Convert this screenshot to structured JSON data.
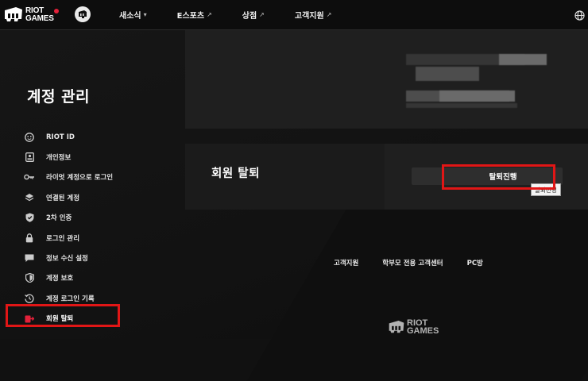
{
  "header": {
    "brand_line1": "RIOT",
    "brand_line2": "GAMES",
    "nav": [
      {
        "label": "새소식",
        "suffix": "▾"
      },
      {
        "label": "E스포츠",
        "suffix": "↗"
      },
      {
        "label": "상점",
        "suffix": "↗"
      },
      {
        "label": "고객지원",
        "suffix": "↗"
      }
    ],
    "globe_icon": "globe-icon"
  },
  "page": {
    "title": "계정 관리"
  },
  "sidebar": {
    "items": [
      {
        "label": "RIOT ID",
        "icon": "face-icon"
      },
      {
        "label": "개인정보",
        "icon": "id-card-icon"
      },
      {
        "label": "라이엇 계정으로 로그인",
        "icon": "key-icon"
      },
      {
        "label": "연결된 계정",
        "icon": "layers-icon"
      },
      {
        "label": "2차 인증",
        "icon": "shield-check-icon"
      },
      {
        "label": "로그인 관리",
        "icon": "lock-icon"
      },
      {
        "label": "정보 수신 설정",
        "icon": "chat-icon"
      },
      {
        "label": "계정 보호",
        "icon": "shield-lock-icon"
      },
      {
        "label": "계정 로그인 기록",
        "icon": "history-icon"
      },
      {
        "label": "회원 탈퇴",
        "icon": "withdraw-icon"
      }
    ]
  },
  "withdraw_card": {
    "title": "회원 탈퇴",
    "button_label": "탈퇴진행",
    "tooltip": "탈퇴진행"
  },
  "footer": {
    "links": [
      "고객지원",
      "학부모 전용 고객센터",
      "PC방"
    ],
    "logo_line1": "RIOT",
    "logo_line2": "GAMES"
  },
  "colors": {
    "accent_red": "#e3213a",
    "highlight_red": "#e11616",
    "bg": "#111111",
    "card": "#1f1f1f"
  }
}
